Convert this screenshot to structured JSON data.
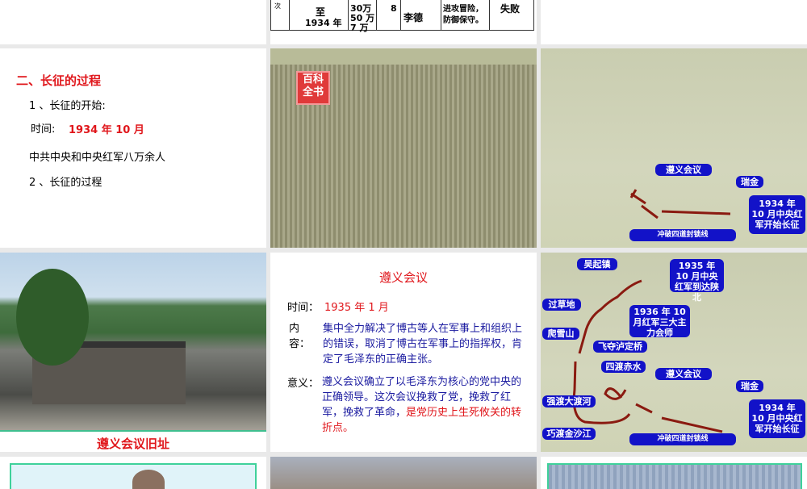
{
  "slide1": {
    "col0": "次",
    "col1": "至",
    "col1b": "1934 年",
    "col2a": "30万",
    "col2b": "万",
    "col2c": "50 万",
    "col2d": "7 万",
    "col3": "8",
    "col4": "李德",
    "col5a": "进攻冒险，",
    "col5b": "防御保守。",
    "col6": "失败"
  },
  "slide4": {
    "title": "二、长征的过程",
    "item1": "1 、长征的开始:",
    "time_label": "时间:",
    "time_value": "1934 年 10 月",
    "who": "中共中央和中央红军八万余人",
    "item2": "2 、长征的过程"
  },
  "slide5": {
    "stamp": "百科全书"
  },
  "map": {
    "zunyi": "遵义会议",
    "ruijin": "瑞金",
    "start": "1934 年 10 月中央红军开始长征",
    "breakthrough": "冲破四道封锁线",
    "wuqi": "吴起镇",
    "arrive": "1935 年 10 月中央红军到达陕北",
    "grassland": "过草地",
    "meet": "1936 年 10 月红军三大主力会师",
    "snow": "爬雪山",
    "luding": "飞夺泸定桥",
    "chishui": "四渡赤水",
    "dadu": "强渡大渡河",
    "jinsha": "巧渡金沙江"
  },
  "slide7": {
    "caption": "遵义会议旧址"
  },
  "slide8": {
    "title": "遵义会议",
    "time_label": "时间：",
    "time_value": "1935 年 1 月",
    "content_label": "内容：",
    "content": "集中全力解决了博古等人在军事上和组织上的错误，取消了博古在军事上的指挥权，肯定了毛泽东的正确主张。",
    "meaning_label": "意义：",
    "meaning_blue": "遵义会议确立了以毛泽东为核心的党中央的正确领导。这次会议挽救了党，挽救了红军，挽救了革命，",
    "meaning_red": "是党历史上生死攸关的转折点。"
  }
}
